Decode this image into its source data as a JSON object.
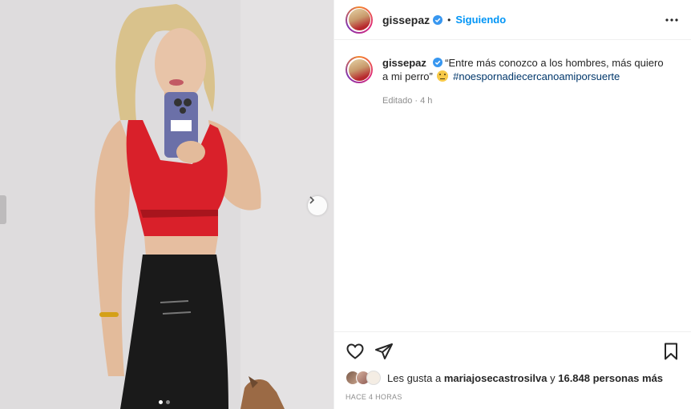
{
  "post": {
    "username": "gissepaz",
    "separator": "•",
    "follow_status": "Siguiendo",
    "caption_text": "“Entre más conozco a los hombres, más quiero a mi perro”",
    "hashtag": "#noespornadiecercanoamiporsuerte",
    "edited_label": "Editado",
    "meta_separator": "·",
    "time_ago": "4 h",
    "likes_prefix": "Les gusta a",
    "likes_user": "mariajosecastrosilva",
    "likes_mid": "y",
    "likes_count": "16.848 personas más",
    "timestamp": "HACE 4 HORAS"
  },
  "carousel": {
    "current": 1,
    "total": 2
  },
  "icons": {
    "verified": "verified-badge-icon",
    "more": "more-options-icon",
    "like": "heart-icon",
    "share": "paper-plane-icon",
    "save": "bookmark-icon",
    "next": "chevron-right-icon",
    "emoji": "smiling-face-emoji"
  },
  "colors": {
    "accent": "#0095f6",
    "hashtag": "#00376b",
    "muted": "#8e8e8e",
    "top_red": "#d9202a"
  }
}
